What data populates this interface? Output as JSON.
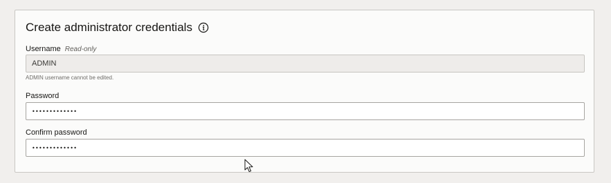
{
  "section": {
    "title": "Create administrator credentials",
    "info_icon": "info-circle-icon"
  },
  "username": {
    "label": "Username",
    "readonly_tag": "Read-only",
    "value": "ADMIN",
    "help": "ADMIN username cannot be edited."
  },
  "password": {
    "label": "Password",
    "value": "•••••••••••••"
  },
  "confirm_password": {
    "label": "Confirm password",
    "value": "•••••••••••••"
  },
  "cursor": {
    "icon": "mouse-pointer-icon"
  }
}
